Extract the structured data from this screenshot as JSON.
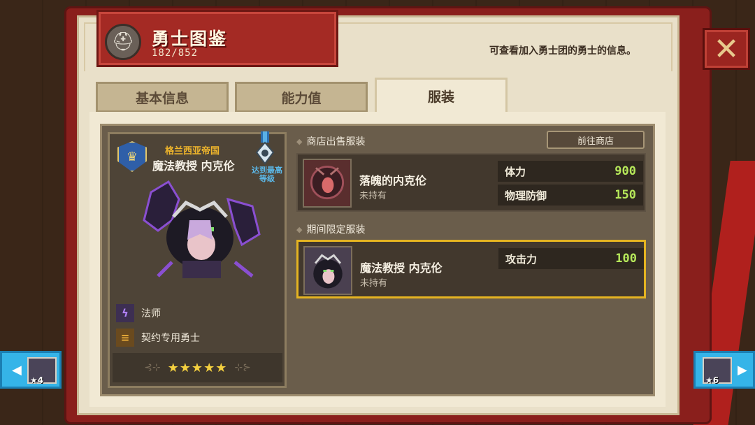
{
  "header": {
    "title": "勇士图鉴",
    "count": "182/852",
    "description": "可查看加入勇士团的勇士的信息。"
  },
  "tabs": [
    {
      "label": "基本信息",
      "active": false
    },
    {
      "label": "能力值",
      "active": false
    },
    {
      "label": "服装",
      "active": true
    }
  ],
  "character": {
    "faction": "格兰西亚帝国",
    "name": "魔法教授 内克伦",
    "max_level_badge": "达到最高等级",
    "class": "法师",
    "contract": "契约专用勇士",
    "stars": "★★★★★"
  },
  "shop_section": {
    "title": "商店出售服装",
    "button": "前往商店",
    "costume": {
      "name": "落魄的内克伦",
      "status": "未持有",
      "stats": [
        {
          "label": "体力",
          "value": "900"
        },
        {
          "label": "物理防御",
          "value": "150"
        }
      ]
    }
  },
  "limited_section": {
    "title": "期间限定服装",
    "costume": {
      "name": "魔法教授 内克伦",
      "status": "未持有",
      "stats": [
        {
          "label": "攻击力",
          "value": "100"
        }
      ]
    }
  },
  "nav": {
    "prev_level": "★4",
    "next_level": "★6"
  },
  "icons": {
    "close": "close-icon",
    "prev": "arrow-left-icon",
    "next": "arrow-right-icon"
  },
  "colors": {
    "accent_gold": "#e5b421",
    "stat_green": "#b6e85a",
    "banner_red": "#a42a24",
    "nav_blue": "#35b4e8"
  }
}
